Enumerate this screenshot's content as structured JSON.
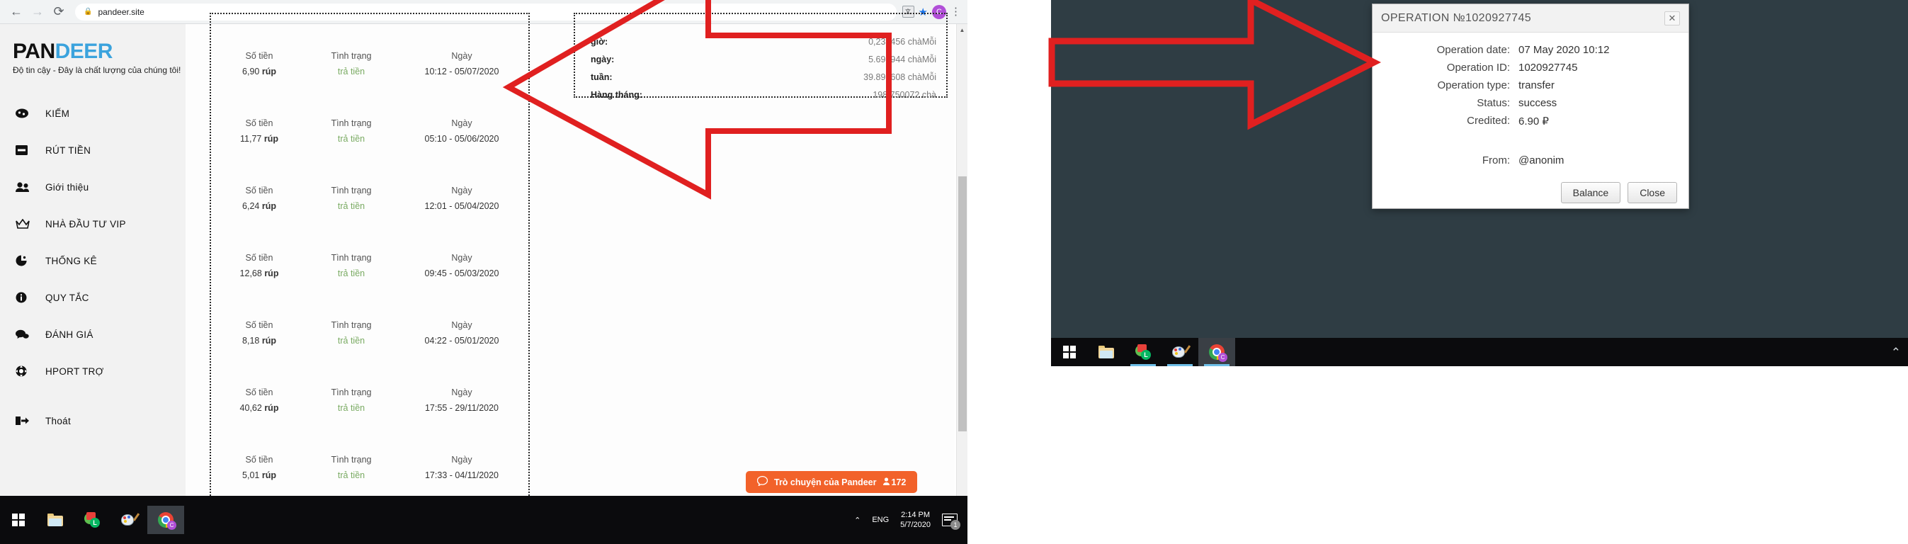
{
  "browser": {
    "url": "pandeer.site",
    "back_icon": "back-arrow-icon",
    "forward_icon": "forward-arrow-icon",
    "reload_icon": "reload-icon",
    "lock_icon": "lock-icon",
    "translate_icon": "translate-icon",
    "bookmark_icon": "star-icon",
    "profile_initial": "C",
    "menu_icon": "kebab-menu-icon"
  },
  "site": {
    "logo_part1": "PAN",
    "logo_part2": "DEER",
    "tagline": "Độ tin cậy - Đây là chất lượng của chúng tôi!",
    "menu": [
      {
        "label": "KIẾM",
        "icon": "coins-icon"
      },
      {
        "label": "RÚT TIỀN",
        "icon": "wallet-icon"
      },
      {
        "label": "Giới thiệu",
        "icon": "people-icon"
      },
      {
        "label": "NHÀ ĐẦU TƯ VIP",
        "icon": "crown-icon"
      },
      {
        "label": "THỐNG KÊ",
        "icon": "pie-chart-icon"
      },
      {
        "label": "QUY TẮC",
        "icon": "info-icon"
      },
      {
        "label": "ĐÁNH GIÁ",
        "icon": "chat-bubble-icon"
      },
      {
        "label": "HPORT TRỢ",
        "icon": "lifebuoy-icon"
      }
    ],
    "exit": {
      "label": "Thoát",
      "icon": "logout-icon"
    }
  },
  "transactions": {
    "headers": {
      "amount": "Số tiền",
      "status": "Tình trạng",
      "date": "Ngày"
    },
    "rows": [
      {
        "amount": "6,90",
        "currency": "rúp",
        "status": "trả tiền",
        "date": "10:12 - 05/07/2020"
      },
      {
        "amount": "11,77",
        "currency": "rúp",
        "status": "trả tiền",
        "date": "05:10 - 05/06/2020"
      },
      {
        "amount": "6,24",
        "currency": "rúp",
        "status": "trả tiền",
        "date": "12:01 - 05/04/2020"
      },
      {
        "amount": "12,68",
        "currency": "rúp",
        "status": "trả tiền",
        "date": "09:45 - 05/03/2020"
      },
      {
        "amount": "8,18",
        "currency": "rúp",
        "status": "trả tiền",
        "date": "04:22 - 05/01/2020"
      },
      {
        "amount": "40,62",
        "currency": "rúp",
        "status": "trả tiền",
        "date": "17:55 - 29/11/2020"
      },
      {
        "amount": "5,01",
        "currency": "rúp",
        "status": "trả tiền",
        "date": "17:33 - 04/11/2020"
      }
    ]
  },
  "earnings": {
    "rows": [
      {
        "label": "giờ:",
        "value": "0,237456 chàMỗi"
      },
      {
        "label": "ngày:",
        "value": "5.698944 chàMỗi"
      },
      {
        "label": "tuần:",
        "value": "39.892608 chàMỗi"
      },
      {
        "label": "Hàng tháng:",
        "value": "198.750072 chà"
      }
    ]
  },
  "chat": {
    "label": "Trò chuyện của Pandeer",
    "online_count": "172",
    "bubble_icon": "chat-bubble-icon",
    "person_icon": "person-icon",
    "color": "#f2622a"
  },
  "taskbar": {
    "start_icon": "windows-start-icon",
    "explorer_icon": "file-explorer-icon",
    "line_icon": "line-app-icon",
    "paint_icon": "paint-app-icon",
    "chrome_icon": "chrome-icon",
    "chevron_icon": "chevron-up-icon",
    "language": "ENG",
    "time": "2:14 PM",
    "date": "5/7/2020",
    "notifications": "1"
  },
  "dialog": {
    "title": "OPERATION №1020927745",
    "close_label": "✕",
    "fields": [
      {
        "label": "Operation date:",
        "value": "07 May 2020 10:12"
      },
      {
        "label": "Operation ID:",
        "value": "1020927745"
      },
      {
        "label": "Operation type:",
        "value": "transfer"
      },
      {
        "label": "Status:",
        "value": "success"
      },
      {
        "label": "Credited:",
        "value": "6.90 ₽"
      }
    ],
    "from": {
      "label": "From:",
      "value": "@anonim"
    },
    "buttons": {
      "balance": "Balance",
      "close": "Close"
    }
  },
  "annotation": {
    "arrow_color": "#e02020"
  }
}
